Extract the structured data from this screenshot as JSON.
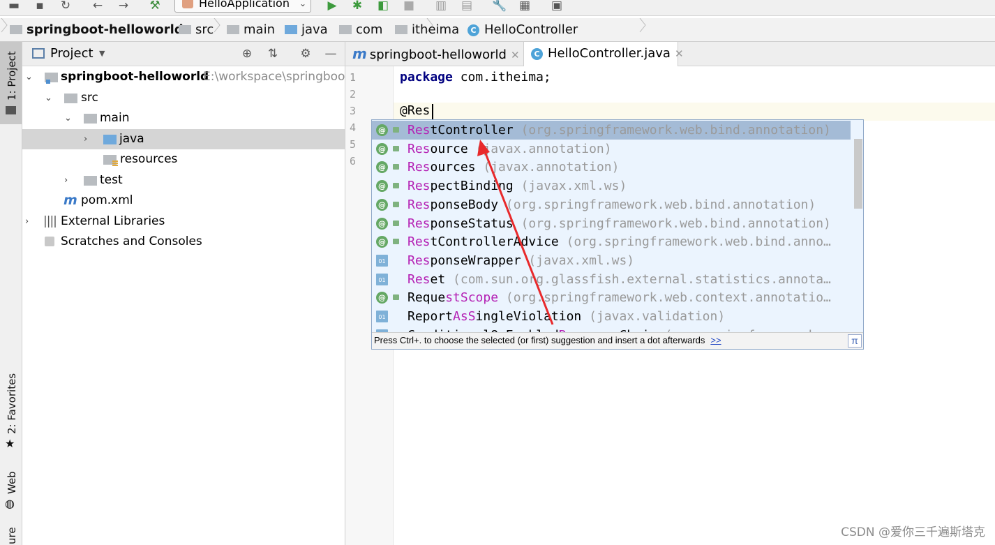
{
  "toolbar": {
    "run_config": "HelloApplication",
    "icons": [
      "open-icon",
      "save-icon",
      "sync-icon",
      "back-icon",
      "forward-icon",
      "build-icon",
      "run-icon",
      "debug-icon",
      "coverage-icon",
      "stop-icon",
      "structure-icon",
      "profile-icon",
      "settings-icon",
      "project-structure-icon",
      "sdk-icon"
    ]
  },
  "breadcrumb": [
    "springboot-helloworld",
    "src",
    "main",
    "java",
    "com",
    "itheima",
    "HelloController"
  ],
  "left_stripe": {
    "project": "1: Project",
    "favorites": "2: Favorites",
    "web": "Web",
    "structure": "ure"
  },
  "project_panel": {
    "title": "Project",
    "tree": [
      {
        "label": "springboot-helloworld",
        "path": "E:\\workspace\\springboo"
      },
      {
        "label": "src"
      },
      {
        "label": "main"
      },
      {
        "label": "java"
      },
      {
        "label": "resources"
      },
      {
        "label": "test"
      },
      {
        "label": "pom.xml"
      },
      {
        "label": "External Libraries"
      },
      {
        "label": "Scratches and Consoles"
      }
    ]
  },
  "editor": {
    "tabs": [
      {
        "label": "springboot-helloworld",
        "icon": "maven-icon"
      },
      {
        "label": "HelloController.java",
        "icon": "class-icon"
      }
    ],
    "line_numbers": [
      "1",
      "2",
      "3",
      "4",
      "5",
      "6"
    ],
    "code": {
      "line1_keyword": "package",
      "line1_rest": " com.itheima;",
      "line3": "@Res"
    }
  },
  "completion": {
    "items": [
      {
        "hl": "Res",
        "rest": "tController",
        "pkg": " (org.springframework.web.bind.annotation)",
        "icon": "annotation-icon"
      },
      {
        "hl": "Res",
        "rest": "ource",
        "pkg": " (javax.annotation)",
        "icon": "annotation-icon"
      },
      {
        "hl": "Res",
        "rest": "ources",
        "pkg": " (javax.annotation)",
        "icon": "annotation-icon"
      },
      {
        "hl": "Res",
        "rest": "pectBinding",
        "pkg": " (javax.xml.ws)",
        "icon": "annotation-icon"
      },
      {
        "hl": "Res",
        "rest": "ponseBody",
        "pkg": " (org.springframework.web.bind.annotation)",
        "icon": "annotation-icon"
      },
      {
        "hl": "Res",
        "rest": "ponseStatus",
        "pkg": " (org.springframework.web.bind.annotation)",
        "icon": "annotation-icon"
      },
      {
        "hl": "Res",
        "rest": "tControllerAdvice",
        "pkg": " (org.springframework.web.bind.anno…",
        "icon": "annotation-icon"
      },
      {
        "hl": "Res",
        "rest": "ponseWrapper",
        "pkg": " (javax.xml.ws)",
        "icon": "class-file-icon"
      },
      {
        "hl": "Res",
        "rest": "et",
        "pkg": " (com.sun.org.glassfish.external.statistics.annota…",
        "icon": "class-file-icon"
      },
      {
        "pre": "Reque",
        "hl": "stScope",
        "rest": "",
        "pkg": " (org.springframework.web.context.annotatio…",
        "icon": "annotation-icon"
      },
      {
        "pre": "Report",
        "hl": "AsS",
        "rest": "ingleViolation",
        "pkg": " (javax.validation)",
        "icon": "class-file-icon"
      },
      {
        "pre": "ConditionalOnEnabled",
        "hl": "Res",
        "rest": "ourceChain",
        "pkg": " (org.springframework…",
        "icon": "class-file-icon"
      }
    ],
    "hint": "Press Ctrl+. to choose the selected (or first) suggestion and insert a dot afterwards",
    "hint_link": ">>",
    "pi": "π"
  },
  "watermark": "CSDN @爱你三千遍斯塔克"
}
